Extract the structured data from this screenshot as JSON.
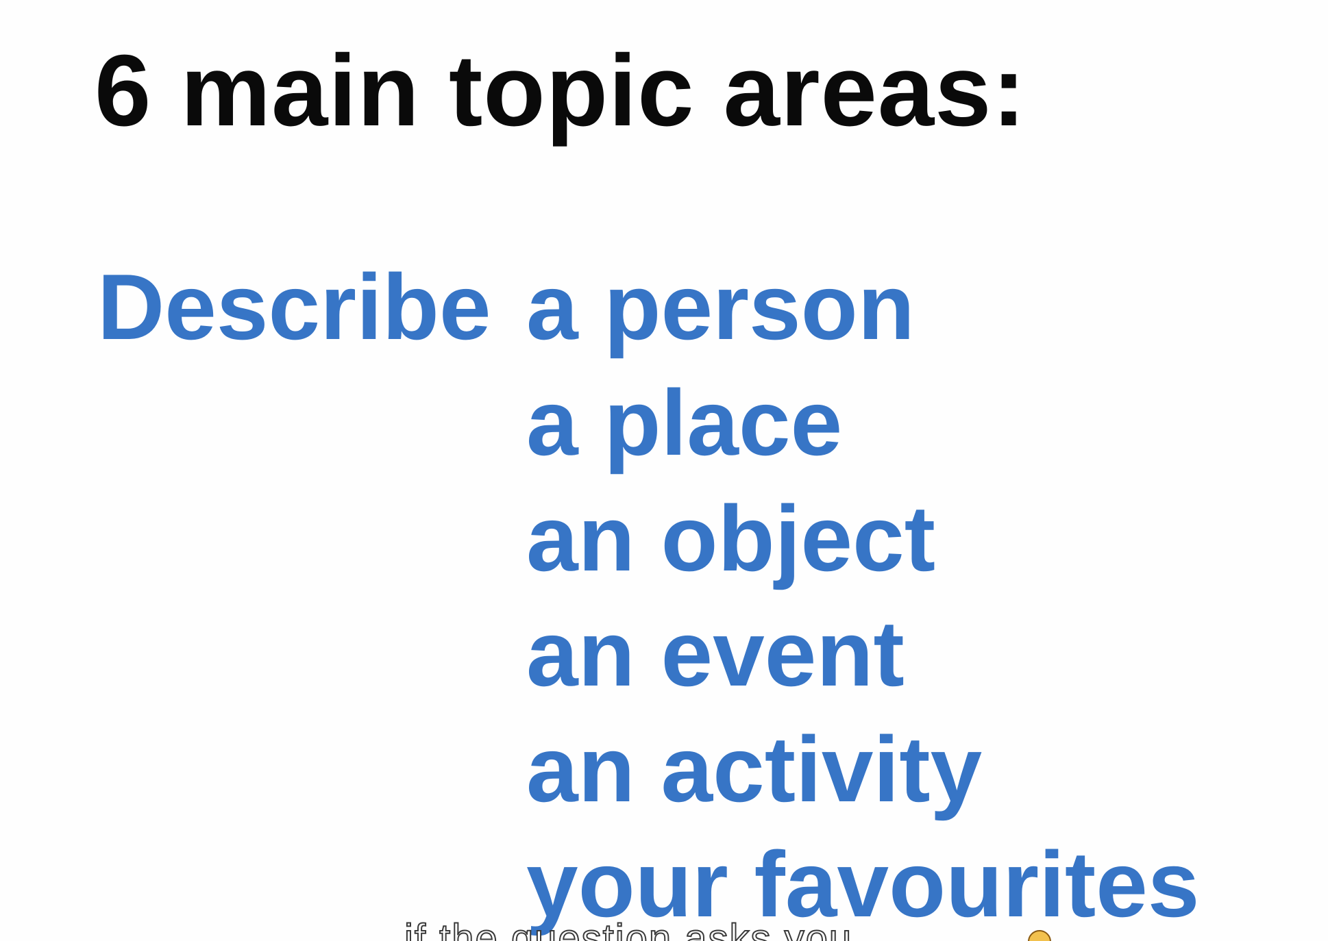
{
  "slide": {
    "title": "6 main topic areas:",
    "lead_word": "Describe",
    "topics": [
      "a person",
      "a place",
      "an object",
      "an event",
      "an activity",
      "your favourites"
    ]
  },
  "caption": {
    "text": "if the question asks you"
  },
  "colors": {
    "title": "#0a0a0a",
    "topics": "#3775c6",
    "background": "#fefefe"
  }
}
